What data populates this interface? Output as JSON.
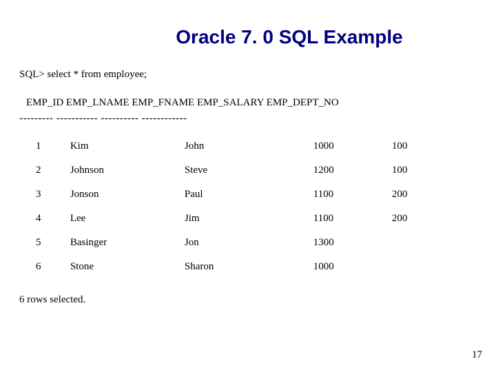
{
  "title": "Oracle 7. 0 SQL Example",
  "sql_prompt": "SQL> select * from employee;",
  "column_header_line": " EMP_ID EMP_LNAME  EMP_FNAME  EMP_SALARY EMP_DEPT_NO",
  "separator_line": "--------- ----------- ---------- ------------",
  "chart_data": {
    "type": "table",
    "columns": [
      "EMP_ID",
      "EMP_LNAME",
      "EMP_FNAME",
      "EMP_SALARY",
      "EMP_DEPT_NO"
    ],
    "rows": [
      {
        "id": "1",
        "lname": "Kim",
        "fname": "John",
        "salary": "1000",
        "dept": "100"
      },
      {
        "id": "2",
        "lname": "Johnson",
        "fname": "Steve",
        "salary": "1200",
        "dept": "100"
      },
      {
        "id": "3",
        "lname": "Jonson",
        "fname": "Paul",
        "salary": "1100",
        "dept": "200"
      },
      {
        "id": "4",
        "lname": "Lee",
        "fname": "Jim",
        "salary": "1100",
        "dept": "200"
      },
      {
        "id": "5",
        "lname": "Basinger",
        "fname": "Jon",
        "salary": "1300",
        "dept": ""
      },
      {
        "id": "6",
        "lname": "Stone",
        "fname": "Sharon",
        "salary": "1000",
        "dept": ""
      }
    ]
  },
  "rows_selected": "6 rows selected.",
  "page_number": "17"
}
